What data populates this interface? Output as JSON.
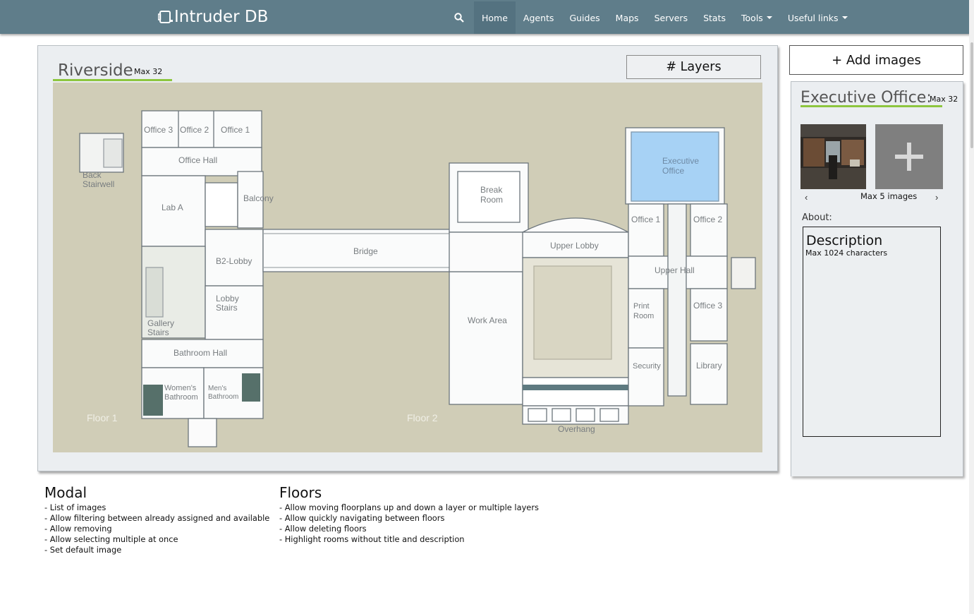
{
  "navbar": {
    "brand": "Intruder DB",
    "items": [
      {
        "label": "Home",
        "active": true
      },
      {
        "label": "Agents"
      },
      {
        "label": "Guides"
      },
      {
        "label": "Maps"
      },
      {
        "label": "Servers"
      },
      {
        "label": "Stats"
      },
      {
        "label": "Tools",
        "dropdown": true
      },
      {
        "label": "Useful links",
        "dropdown": true
      }
    ],
    "icons": {
      "search": "search-icon",
      "brand": "controller-icon"
    },
    "colors": {
      "bar": "#5f7d8a",
      "active": "#547280"
    }
  },
  "map": {
    "title": "Riverside",
    "max": "Max 32",
    "layers_button": "# Layers",
    "accent": "#8dc63f",
    "floor_labels": [
      "Floor 1",
      "Floor 2"
    ],
    "rooms": {
      "office3": "Office 3",
      "office2": "Office 2",
      "office1": "Office 1",
      "office_hall": "Office Hall",
      "back": "Back",
      "stairwell": "Stairwell",
      "lab_a": "Lab A",
      "balcony": "Balcony",
      "b2_lobby": "B2-Lobby",
      "lobby": "Lobby",
      "stairs": "Stairs",
      "gallery": "Gallery",
      "gallery_stairs": "Stairs",
      "bathroom_hall": "Bathroom Hall",
      "womens": "Women's",
      "womens_bath": "Bathroom",
      "mens": "Men's",
      "mens_bath": "Bathroom",
      "bridge": "Bridge",
      "break": "Break",
      "break_room": "Room",
      "work_area": "Work Area",
      "upper_lobby": "Upper Lobby",
      "overhang": "Overhang",
      "executive": "Executive",
      "executive_office": "Office",
      "r_office1": "Office 1",
      "r_office2": "Office 2",
      "upper_hall": "Upper Hall",
      "print": "Print",
      "print_room": "Room",
      "r_office3": "Office 3",
      "security": "Security",
      "library": "Library"
    },
    "highlight_color": "#a7d2f5"
  },
  "add_images_button": "+ Add images",
  "room_panel": {
    "title": "Executive Office:",
    "max": "Max 32",
    "max_images": "Max 5 images",
    "prev": "‹",
    "next": "›",
    "about_label": "About:",
    "description_title": "Description",
    "description_hint": "Max 1024 characters",
    "icons": {
      "add": "plus-icon"
    }
  },
  "notes": {
    "modal": {
      "title": "Modal",
      "items": [
        "- List of images",
        "- Allow filtering between already assigned and available",
        "- Allow removing",
        "- Allow selecting multiple at once",
        "- Set default image"
      ]
    },
    "floors": {
      "title": "Floors",
      "items": [
        "- Allow moving floorplans up and down a layer or multiple layers",
        "- Allow quickly navigating between floors",
        "- Allow deleting floors",
        "- Highlight rooms without title and description"
      ]
    }
  }
}
